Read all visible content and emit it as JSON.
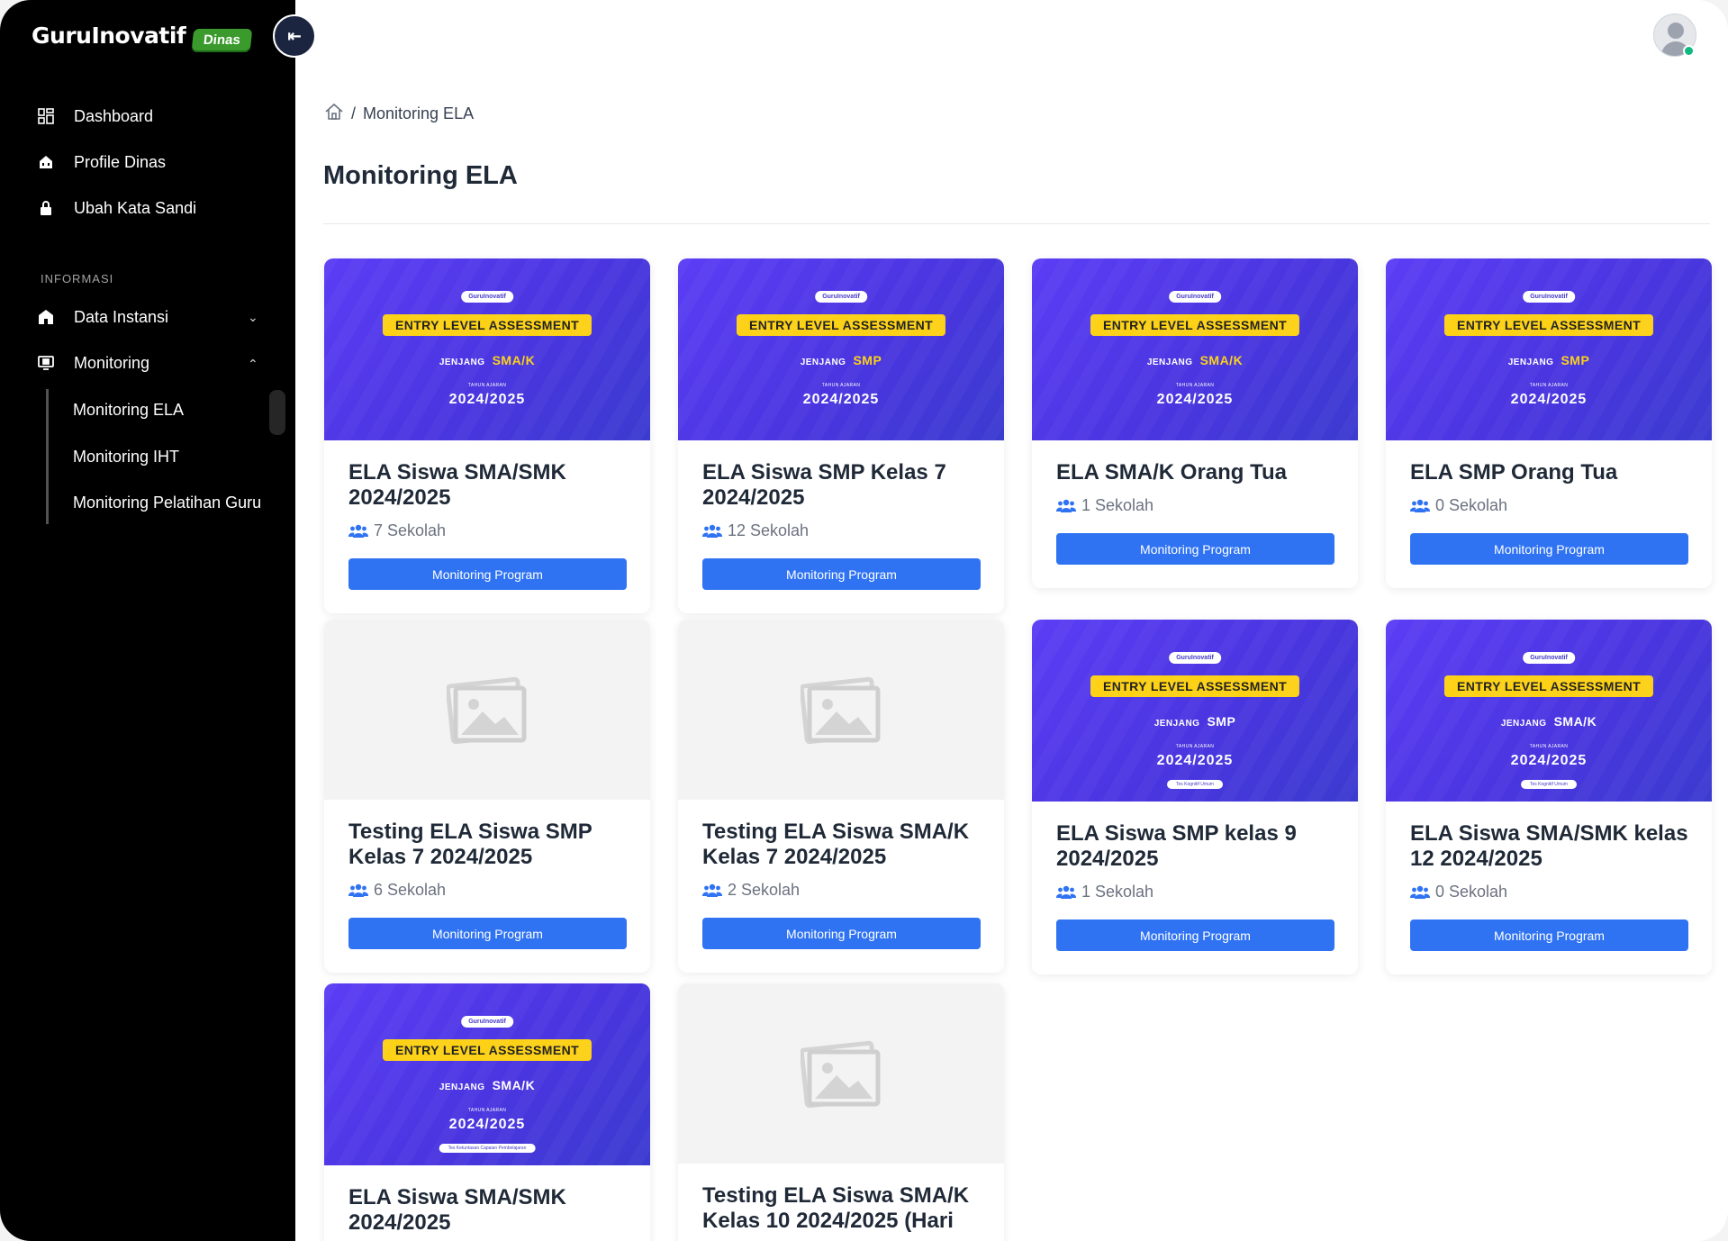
{
  "brand": {
    "name": "GuruInovatif",
    "badge": "Dinas"
  },
  "sidebar": {
    "collapse_icon": "collapse-left-icon",
    "items": [
      {
        "label": "Dashboard",
        "icon": "grid-icon"
      },
      {
        "label": "Profile Dinas",
        "icon": "building-icon"
      },
      {
        "label": "Ubah Kata Sandi",
        "icon": "lock-icon"
      }
    ],
    "section_label": "INFORMASI",
    "groups": [
      {
        "label": "Data Instansi",
        "icon": "building-icon",
        "expanded": false
      },
      {
        "label": "Monitoring",
        "icon": "monitor-icon",
        "expanded": true
      }
    ],
    "sub_items": [
      {
        "label": "Monitoring ELA",
        "active": true
      },
      {
        "label": "Monitoring IHT",
        "active": false
      },
      {
        "label": "Monitoring Pelatihan Guru",
        "active": false
      }
    ]
  },
  "header": {
    "avatar": "user-avatar",
    "status": "online"
  },
  "breadcrumb": {
    "home_icon": "home-icon",
    "separator": "/",
    "current": "Monitoring ELA"
  },
  "page_title": "Monitoring ELA",
  "banner": {
    "logo": "GuruInovatif",
    "ela": "ENTRY LEVEL ASSESSMENT",
    "jenjang_label": "JENJANG",
    "tahun_label": "TAHUN AJARAN"
  },
  "cards": [
    {
      "title": "ELA Siswa SMA/SMK 2024/2025",
      "count": "7 Sekolah",
      "button": "Monitoring Program",
      "banner": {
        "level": "SMA/K",
        "year": "2024/2025",
        "tag": ""
      }
    },
    {
      "title": "ELA Siswa SMP Kelas 7 2024/2025",
      "count": "12 Sekolah",
      "button": "Monitoring Program",
      "banner": {
        "level": "SMP",
        "year": "2024/2025",
        "tag": ""
      }
    },
    {
      "title": "ELA SMA/K Orang Tua",
      "count": "1 Sekolah",
      "button": "Monitoring Program",
      "banner": {
        "level": "SMA/K",
        "year": "2024/2025",
        "tag": ""
      }
    },
    {
      "title": "ELA SMP Orang Tua",
      "count": "0 Sekolah",
      "button": "Monitoring Program",
      "banner": {
        "level": "SMP",
        "year": "2024/2025",
        "tag": ""
      }
    },
    {
      "title": "Testing ELA Siswa SMP Kelas 7 2024/2025",
      "count": "6 Sekolah",
      "button": "Monitoring Program",
      "banner": null
    },
    {
      "title": "Testing ELA Siswa SMA/K Kelas 7 2024/2025",
      "count": "2 Sekolah",
      "button": "Monitoring Program",
      "banner": null
    },
    {
      "title": "ELA Siswa SMP kelas 9 2024/2025",
      "count": "1 Sekolah",
      "button": "Monitoring Program",
      "banner": {
        "level": "SMP",
        "year": "2024/2025",
        "tag": "Tes Kognitif Umum"
      }
    },
    {
      "title": "ELA Siswa SMA/SMK kelas 12 2024/2025",
      "count": "0 Sekolah",
      "button": "Monitoring Program",
      "banner": {
        "level": "SMA/K",
        "year": "2024/2025",
        "tag": "Tes Kognitif Umum"
      }
    },
    {
      "title": "ELA Siswa SMA/SMK 2024/2025",
      "count": "",
      "button": "",
      "banner": {
        "level": "SMA/K",
        "year": "2024/2025",
        "tag": "Tes Ketuntasan Capaian Pembelajaran"
      }
    },
    {
      "title": "Testing ELA Siswa SMA/K Kelas 10 2024/2025 (Hari",
      "count": "",
      "button": "",
      "banner": null
    }
  ],
  "colors": {
    "sidebar_bg": "#000000",
    "primary": "#2f73f3",
    "banner": "#4a35e0",
    "badge": "#3a9a2c",
    "highlight": "#fcd116"
  }
}
